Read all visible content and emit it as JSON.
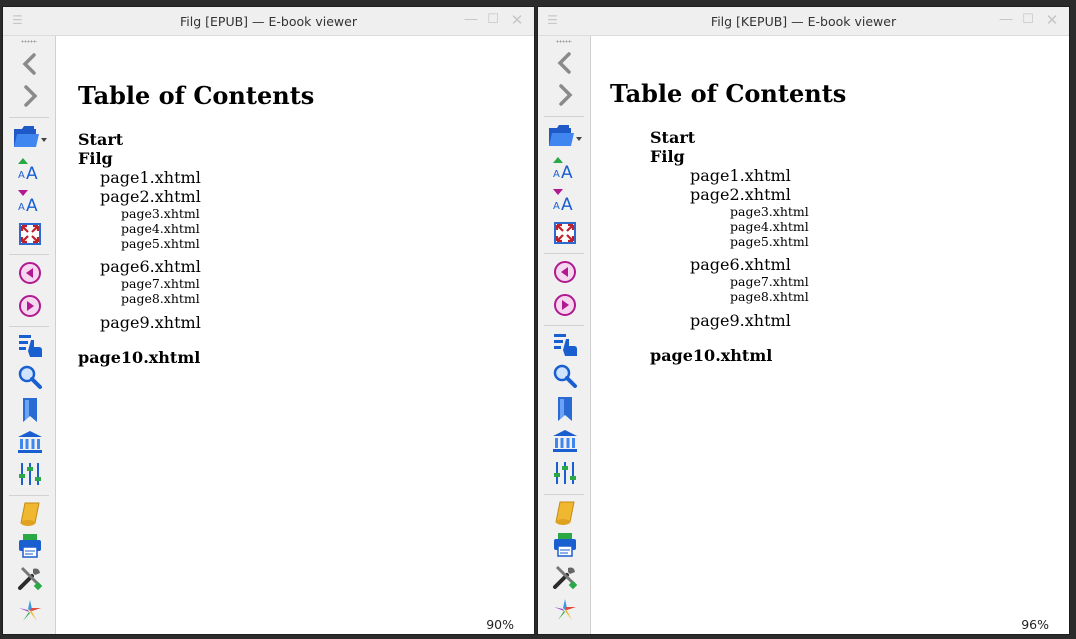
{
  "windows": [
    {
      "title": "Filg [EPUB] — E-book viewer",
      "zoom": "90%",
      "toc": {
        "heading": "Table of Contents",
        "start": "Start",
        "filg": "Filg",
        "page1": "page1.xhtml",
        "page2": "page2.xhtml",
        "page3": "page3.xhtml",
        "page4": "page4.xhtml",
        "page5": "page5.xhtml",
        "page6": "page6.xhtml",
        "page7": "page7.xhtml",
        "page8": "page8.xhtml",
        "page9": "page9.xhtml",
        "page10": "page10.xhtml"
      }
    },
    {
      "title": "Filg [KEPUB] — E-book viewer",
      "zoom": "96%",
      "toc": {
        "heading": "Table of Contents",
        "start": "Start",
        "filg": "Filg",
        "page1": "page1.xhtml",
        "page2": "page2.xhtml",
        "page3": "page3.xhtml",
        "page4": "page4.xhtml",
        "page5": "page5.xhtml",
        "page6": "page6.xhtml",
        "page7": "page7.xhtml",
        "page8": "page8.xhtml",
        "page9": "page9.xhtml",
        "page10": "page10.xhtml"
      }
    }
  ],
  "toolbar_icons": [
    "back-arrow-icon",
    "forward-arrow-icon",
    "open-folder-icon",
    "font-size-increase-icon",
    "font-size-decrease-icon",
    "fullscreen-icon",
    "previous-page-icon",
    "next-page-icon",
    "table-of-contents-icon",
    "search-icon",
    "bookmark-icon",
    "library-icon",
    "preferences-sliders-icon",
    "scroll-reference-icon",
    "print-icon",
    "tools-icon",
    "calibre-logo-icon"
  ],
  "colors": {
    "accent_blue": "#1a5fd0",
    "magenta": "#b0198f",
    "green": "#2aa845",
    "fullscreen_red": "#c0202a"
  }
}
